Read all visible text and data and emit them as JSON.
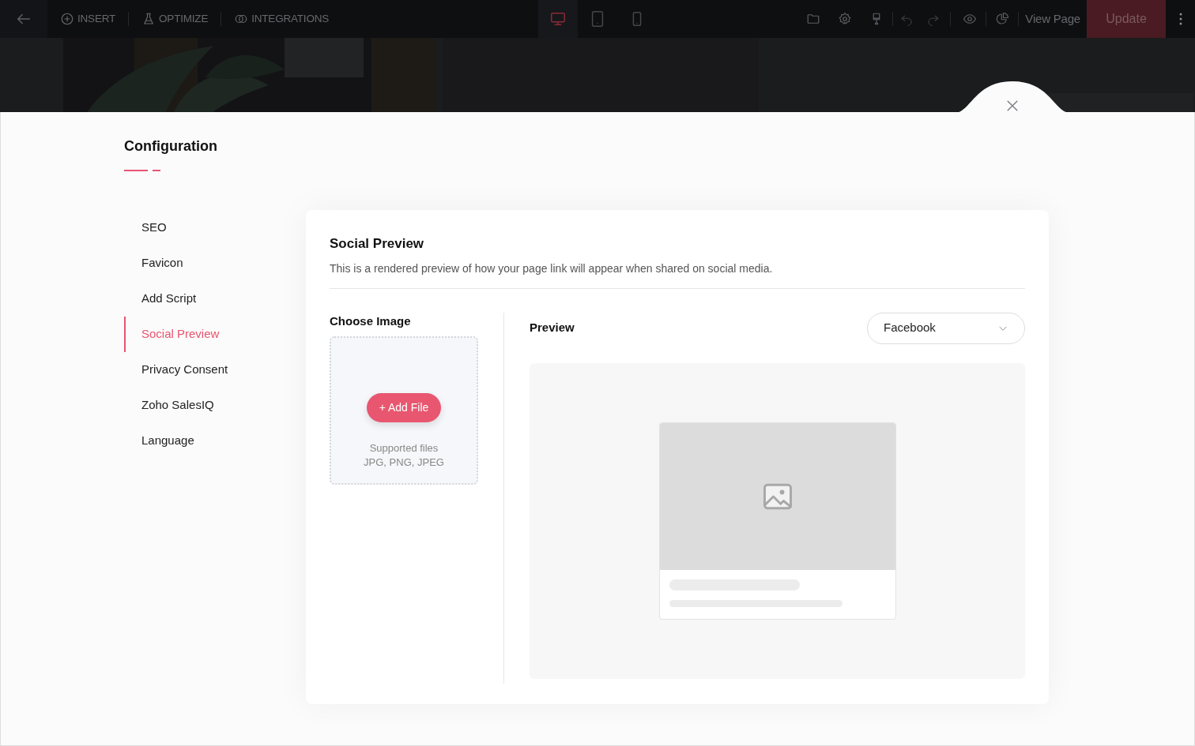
{
  "toolbar": {
    "left_items": [
      {
        "kind": "insert",
        "label": "INSERT"
      },
      {
        "kind": "optimize",
        "label": "OPTIMIZE"
      },
      {
        "kind": "integrations",
        "label": "INTEGRATIONS"
      }
    ],
    "devices": [
      {
        "kind": "desktop",
        "selected": true
      },
      {
        "kind": "tablet",
        "selected": false
      },
      {
        "kind": "phone",
        "selected": false
      }
    ],
    "view_page": "View Page",
    "update": "Update"
  },
  "configuration": {
    "title": "Configuration",
    "menu": [
      {
        "label": "SEO",
        "selected": false
      },
      {
        "label": "Favicon",
        "selected": false
      },
      {
        "label": "Add Script",
        "selected": false
      },
      {
        "label": "Social Preview",
        "selected": true
      },
      {
        "label": "Privacy Consent",
        "selected": false
      },
      {
        "label": "Zoho SalesIQ",
        "selected": false
      },
      {
        "label": "Language",
        "selected": false
      }
    ]
  },
  "social_preview": {
    "title": "Social Preview",
    "description": "This is a rendered preview of how your page link will appear when shared on social media.",
    "choose_image": {
      "label": "Choose Image",
      "button": "+ Add File",
      "supported": [
        "Supported files",
        "JPG, PNG, JPEG"
      ]
    },
    "preview": {
      "label": "Preview",
      "platform": "Facebook"
    }
  }
}
